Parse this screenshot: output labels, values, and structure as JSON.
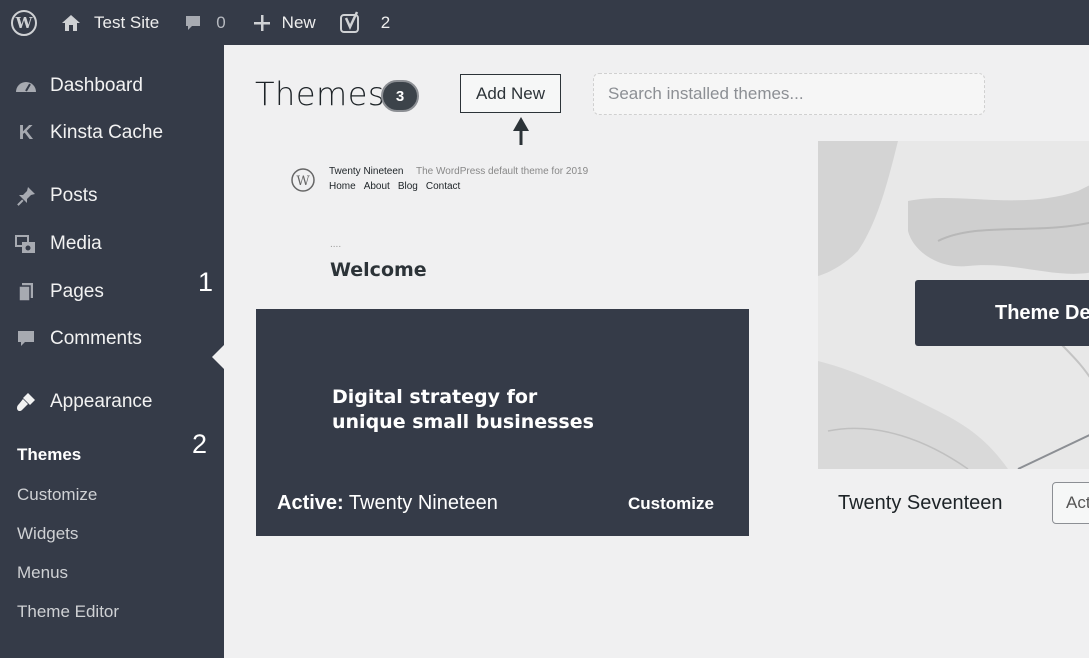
{
  "adminbar": {
    "site_name": "Test Site",
    "comments_count": "0",
    "new_label": "New",
    "yoast_count": "2",
    "icons": [
      "wordpress-icon",
      "home-icon",
      "comment-icon",
      "plus-icon",
      "yoast-icon"
    ]
  },
  "sidebar": {
    "items": [
      {
        "label": "Dashboard",
        "icon": "dashboard-icon"
      },
      {
        "label": "Kinsta Cache",
        "icon": "kinsta-icon"
      },
      {
        "label": "Posts",
        "icon": "pin-icon"
      },
      {
        "label": "Media",
        "icon": "media-icon"
      },
      {
        "label": "Pages",
        "icon": "pages-icon"
      },
      {
        "label": "Comments",
        "icon": "comment-icon"
      },
      {
        "label": "Appearance",
        "icon": "brush-icon"
      }
    ],
    "submenu": [
      {
        "label": "Themes",
        "current": true
      },
      {
        "label": "Customize"
      },
      {
        "label": "Widgets"
      },
      {
        "label": "Menus"
      },
      {
        "label": "Theme Editor"
      }
    ],
    "annotations": [
      "1",
      "2"
    ]
  },
  "main": {
    "title": "Themes",
    "count": "3",
    "add_new_label": "Add New",
    "search_placeholder": "Search installed themes...",
    "step_marker": "3"
  },
  "themes": [
    {
      "preview": {
        "site_title": "Twenty Nineteen",
        "tagline": "The WordPress default theme for 2019",
        "nav": [
          "Home",
          "About",
          "Blog",
          "Contact"
        ],
        "dots": "....",
        "welcome": "Welcome",
        "hero_line1": "Digital strategy for",
        "hero_line2": "unique small businesses"
      },
      "active_prefix": "Active:",
      "name": "Twenty Nineteen",
      "customize_label": "Customize"
    },
    {
      "name": "Twenty Seventeen",
      "details_label": "Theme Details",
      "activate_label": "Activate"
    }
  ]
}
